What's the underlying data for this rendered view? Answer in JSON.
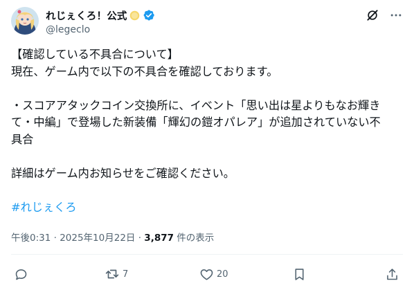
{
  "author": {
    "display_name": "れじぇくろ！公式",
    "handle": "@legeclo",
    "verified": true,
    "brand_color": "#1d9bf0"
  },
  "icons": {
    "grok": "grok-icon",
    "more": "more-icon",
    "reply": "reply-icon",
    "retweet": "retweet-icon",
    "like": "like-icon",
    "bookmark": "bookmark-icon",
    "share": "share-icon"
  },
  "tweet": {
    "lines": [
      "【確認している不具合について】",
      "現在、ゲーム内で以下の不具合を確認しております。",
      "",
      "・スコアアタックコイン交換所に、イベント「思い出は星よりもなお輝き",
      "て・中編」で登場した新装備「輝幻の鎧オパレア」が追加されていない不",
      "具合",
      "",
      "詳細はゲーム内お知らせをご確認ください。",
      ""
    ],
    "hashtag": "#れじぇくろ"
  },
  "meta": {
    "time": "午後0:31",
    "separator": " · ",
    "date": "2025年10月22日",
    "views_count": "3,877",
    "views_label": " 件の表示"
  },
  "actions": {
    "retweet_count": "7",
    "like_count": "20"
  }
}
